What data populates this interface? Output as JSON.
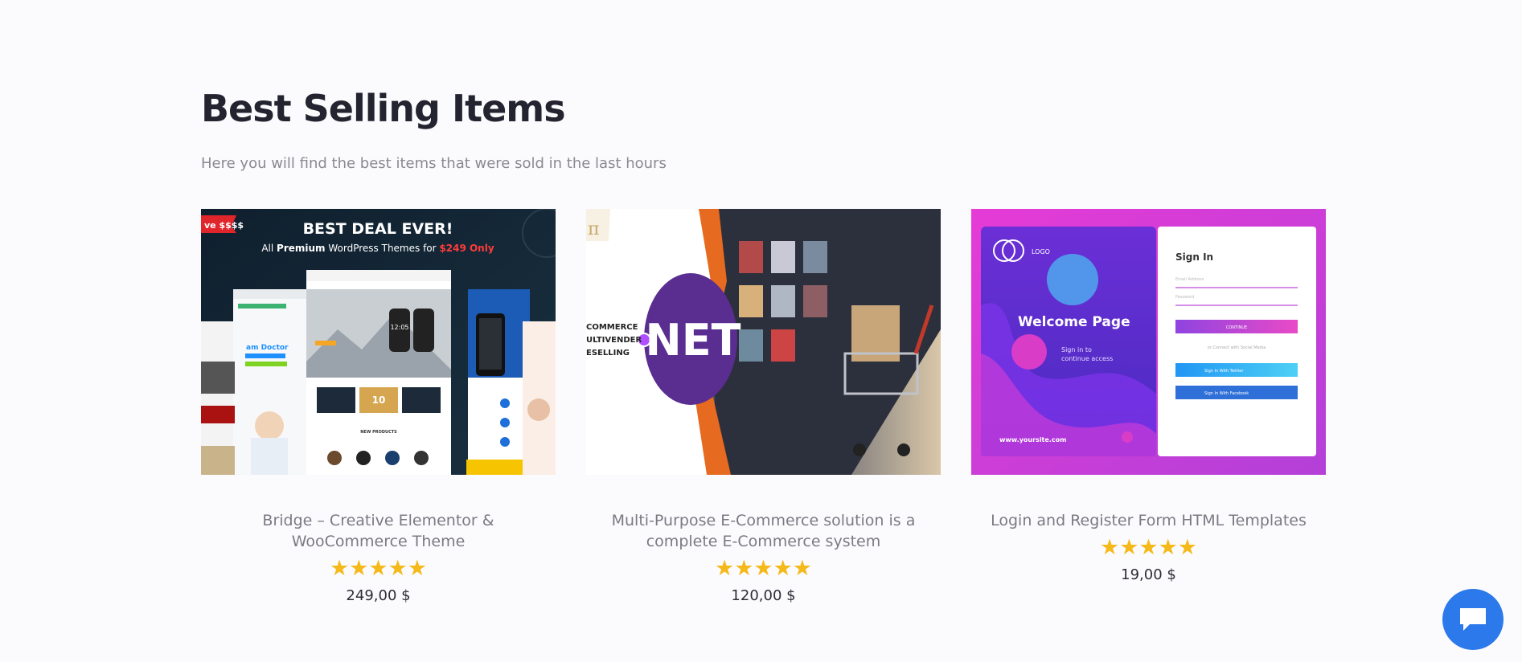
{
  "section": {
    "title": "Best Selling Items",
    "subtitle": "Here you will find the best items that were sold in the last hours"
  },
  "products": [
    {
      "title": "Bridge – Creative Elementor & WooCommerce Theme",
      "rating": "★★★★★",
      "rating_value": 5,
      "price": "249,00 $",
      "thumb": {
        "headline": "BEST DEAL EVER!",
        "subline_prefix": "All ",
        "subline_bold": "Premium",
        "subline_mid": " WordPress Themes for ",
        "subline_price": "$249 Only",
        "badge": "ve $$$$",
        "doctor_label": "am Doctor",
        "new_products": "NEW PRODUCTS",
        "time": "12:05"
      }
    },
    {
      "title": "Multi-Purpose E-Commerce solution is a complete E-Commerce system",
      "rating": "★★★★★",
      "rating_value": 5,
      "price": "120,00 $",
      "thumb": {
        "logo_text": "NET",
        "side_text_1": "COMMERCE",
        "side_text_2": "ULTIVENDER",
        "side_text_3": "ESELLING"
      }
    },
    {
      "title": "Login and Register Form HTML Templates",
      "rating": "★★★★★",
      "rating_value": 5,
      "price": "19,00 $",
      "thumb": {
        "logo": "LOGO",
        "welcome": "Welcome Page",
        "sign_in_sub_1": "Sign in to",
        "sign_in_sub_2": "continue access",
        "site": "www.yoursite.com",
        "form_title": "Sign In",
        "email_label": "Email Address",
        "password_label": "Password",
        "continue": "CONTINUE",
        "social_divider": "or Connect with Social Media",
        "twitter": "Sign In With Twitter",
        "facebook": "Sign In With Facebook"
      }
    }
  ],
  "colors": {
    "star": "#f6b91a",
    "chat": "#2b79ea",
    "title": "#242430"
  },
  "chat": {
    "icon": "chat-bubble-icon"
  }
}
